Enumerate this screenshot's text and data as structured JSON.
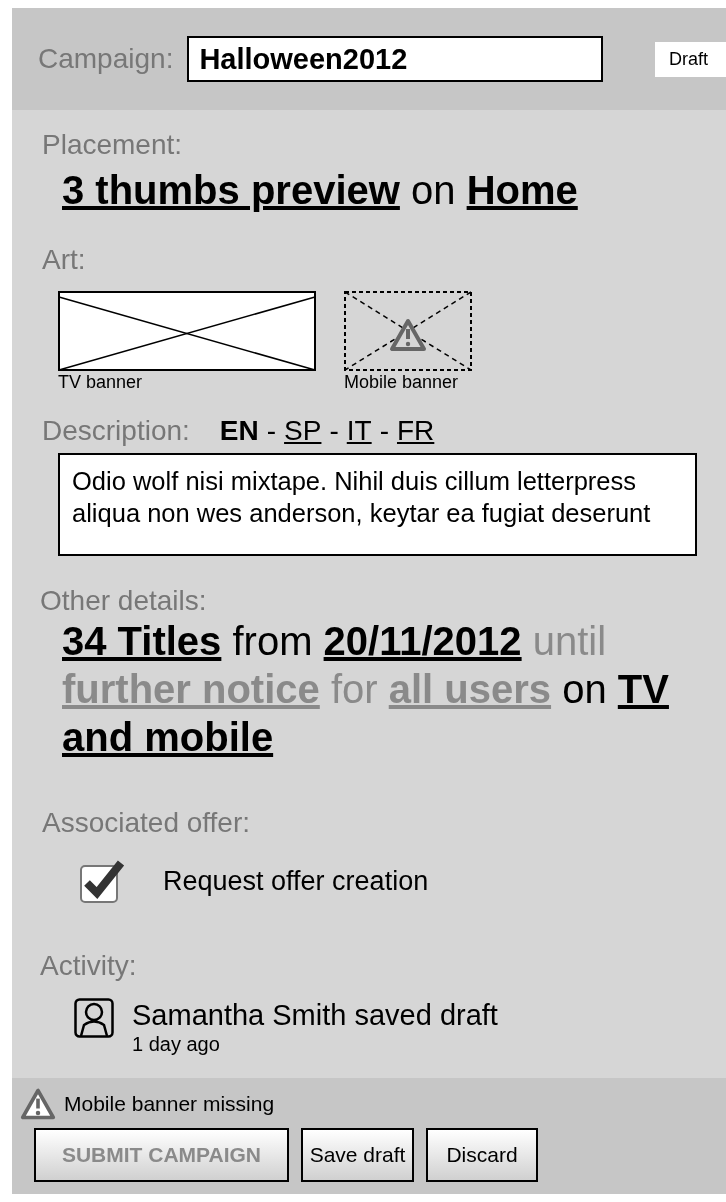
{
  "header": {
    "label": "Campaign:",
    "name_value": "Halloween2012",
    "status": "Draft"
  },
  "placement": {
    "label": "Placement:",
    "parts": [
      {
        "text": "3 thumbs preview",
        "kind": "link",
        "muted": false
      },
      {
        "text": "on",
        "kind": "plain",
        "muted": false
      },
      {
        "text": "Home",
        "kind": "link",
        "muted": false
      }
    ]
  },
  "art": {
    "label": "Art:",
    "items": [
      {
        "caption": "TV banner",
        "missing": false
      },
      {
        "caption": "Mobile banner",
        "missing": true
      }
    ]
  },
  "description": {
    "label": "Description:",
    "languages": [
      {
        "code": "EN",
        "selected": true
      },
      {
        "code": "SP",
        "selected": false
      },
      {
        "code": "IT",
        "selected": false
      },
      {
        "code": "FR",
        "selected": false
      }
    ],
    "separator": "-",
    "text": "Odio wolf nisi mixtape. Nihil duis cillum letterpress aliqua non wes anderson, keytar ea fugiat deserunt"
  },
  "other_details": {
    "label": "Other details:",
    "parts": [
      {
        "text": "34 Titles",
        "kind": "link",
        "muted": false
      },
      {
        "text": "from",
        "kind": "plain",
        "muted": false
      },
      {
        "text": "20/11/2012",
        "kind": "link",
        "muted": false
      },
      {
        "text": "until",
        "kind": "plain",
        "muted": true
      },
      {
        "text": "further notice",
        "kind": "link",
        "muted": true
      },
      {
        "text": "for",
        "kind": "plain",
        "muted": true
      },
      {
        "text": "all users",
        "kind": "link",
        "muted": true
      },
      {
        "text": "on",
        "kind": "plain",
        "muted": false
      },
      {
        "text": "TV",
        "kind": "link",
        "muted": false
      },
      {
        "text": "and mobile",
        "kind": "link",
        "muted": false
      }
    ]
  },
  "associated_offer": {
    "label": "Associated offer:",
    "option": {
      "label": "Request offer creation",
      "checked": true
    }
  },
  "activity": {
    "label": "Activity:",
    "entries": [
      {
        "text": "Samantha Smith saved draft",
        "time": "1 day ago"
      }
    ]
  },
  "footer": {
    "warning": "Mobile banner missing",
    "buttons": [
      {
        "label": "SUBMIT CAMPAIGN",
        "kind": "primary",
        "disabled": true
      },
      {
        "label": "Save draft",
        "kind": "secondary",
        "disabled": false
      },
      {
        "label": "Discard",
        "kind": "secondary",
        "disabled": false
      }
    ]
  }
}
